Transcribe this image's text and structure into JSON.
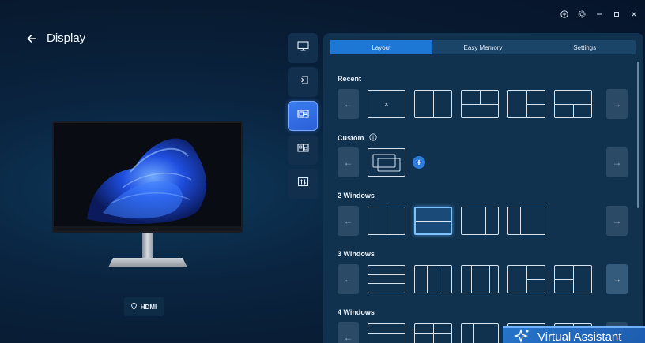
{
  "window": {
    "controls": [
      "plus-circle",
      "gear",
      "minimize",
      "maximize",
      "close"
    ]
  },
  "header": {
    "title": "Display"
  },
  "monitor": {
    "input_label": "HDMI"
  },
  "sidenav": {
    "items": [
      "display-icon",
      "input-icon",
      "layout-icon",
      "pip-icon",
      "settings-sliders-icon"
    ],
    "active_index": 2
  },
  "tabs": [
    {
      "label": "Layout",
      "active": true
    },
    {
      "label": "Easy Memory",
      "active": false
    },
    {
      "label": "Settings",
      "active": false
    }
  ],
  "sections": {
    "recent": {
      "label": "Recent",
      "x_mark": "×"
    },
    "custom": {
      "label": "Custom",
      "add_symbol": "+"
    },
    "two": {
      "label": "2 Windows"
    },
    "three": {
      "label": "3 Windows"
    },
    "four": {
      "label": "4 Windows"
    }
  },
  "assistant": {
    "label": "Virtual Assistant"
  },
  "colors": {
    "accent": "#1c78d4",
    "background": "#0a2440",
    "panel": "#10324f"
  }
}
